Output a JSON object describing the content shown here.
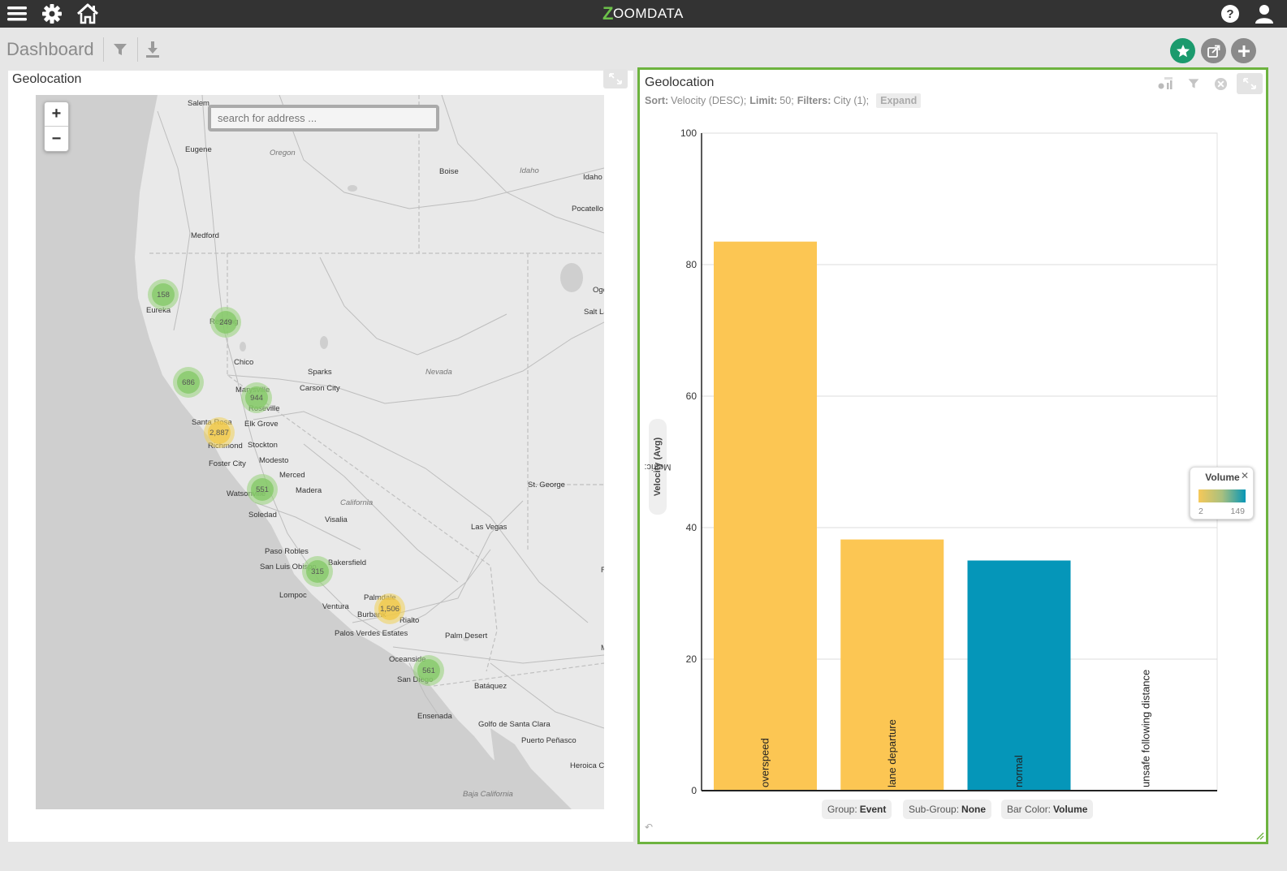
{
  "topbar": {
    "logo_mark": "Z",
    "logo_text": "OOMDATA",
    "icons": [
      "menu-icon",
      "gear-icon",
      "home-icon",
      "help-icon",
      "user-icon"
    ]
  },
  "dashboard": {
    "title": "Dashboard",
    "tools": [
      "filter-icon",
      "download-icon"
    ],
    "actions": [
      "star-icon",
      "share-icon",
      "add-icon"
    ],
    "colors": {
      "star": "#1b9a6d",
      "share": "#8a8a8a",
      "add": "#8a8a8a",
      "panel_border": "#6db33f"
    }
  },
  "map_panel": {
    "title": "Geolocation",
    "search_placeholder": "search for address ...",
    "zoom_in": "+",
    "zoom_out": "−",
    "places": [
      {
        "name": "Salem",
        "cls": ""
      },
      {
        "name": "Eugene",
        "cls": ""
      },
      {
        "name": "Oregon",
        "cls": "region"
      },
      {
        "name": "Boise",
        "cls": ""
      },
      {
        "name": "Idaho",
        "cls": "region"
      },
      {
        "name": "Idaho F",
        "cls": ""
      },
      {
        "name": "Pocatello",
        "cls": ""
      },
      {
        "name": "Medford",
        "cls": ""
      },
      {
        "name": "Ogo",
        "cls": ""
      },
      {
        "name": "Salt La",
        "cls": ""
      },
      {
        "name": "Eureka",
        "cls": ""
      },
      {
        "name": "Redding",
        "cls": ""
      },
      {
        "name": "Chico",
        "cls": ""
      },
      {
        "name": "Sparks",
        "cls": ""
      },
      {
        "name": "Nevada",
        "cls": "region"
      },
      {
        "name": "Carson City",
        "cls": ""
      },
      {
        "name": "Marysville",
        "cls": ""
      },
      {
        "name": "Roseville",
        "cls": ""
      },
      {
        "name": "Santa Rosa",
        "cls": ""
      },
      {
        "name": "Elk Grove",
        "cls": ""
      },
      {
        "name": "Richmond",
        "cls": ""
      },
      {
        "name": "Stockton",
        "cls": ""
      },
      {
        "name": "Modesto",
        "cls": ""
      },
      {
        "name": "Foster City",
        "cls": ""
      },
      {
        "name": "Merced",
        "cls": ""
      },
      {
        "name": "Watsonville",
        "cls": ""
      },
      {
        "name": "Madera",
        "cls": ""
      },
      {
        "name": "California",
        "cls": "region"
      },
      {
        "name": "St. George",
        "cls": ""
      },
      {
        "name": "Soledad",
        "cls": ""
      },
      {
        "name": "Visalia",
        "cls": ""
      },
      {
        "name": "Las Vegas",
        "cls": ""
      },
      {
        "name": "Paso Robles",
        "cls": ""
      },
      {
        "name": "Bakersfield",
        "cls": ""
      },
      {
        "name": "San Luis Obispo",
        "cls": ""
      },
      {
        "name": "Lompoc",
        "cls": ""
      },
      {
        "name": "Palmdale",
        "cls": ""
      },
      {
        "name": "Ventura",
        "cls": ""
      },
      {
        "name": "Burbank",
        "cls": ""
      },
      {
        "name": "Rialto",
        "cls": ""
      },
      {
        "name": "Palos Verdes Estates",
        "cls": ""
      },
      {
        "name": "Palm Desert",
        "cls": ""
      },
      {
        "name": "Oceanside",
        "cls": ""
      },
      {
        "name": "San Diego",
        "cls": ""
      },
      {
        "name": "Batáquez",
        "cls": ""
      },
      {
        "name": "Ensenada",
        "cls": ""
      },
      {
        "name": "Golfo de Santa Clara",
        "cls": ""
      },
      {
        "name": "Puerto Peñasco",
        "cls": ""
      },
      {
        "name": "Heroica Ca",
        "cls": ""
      },
      {
        "name": "Baja California",
        "cls": "region"
      },
      {
        "name": "F",
        "cls": ""
      },
      {
        "name": "M",
        "cls": ""
      }
    ],
    "clusters": [
      {
        "count": "158",
        "color": "green"
      },
      {
        "count": "249",
        "color": "green"
      },
      {
        "count": "686",
        "color": "green"
      },
      {
        "count": "944",
        "color": "green"
      },
      {
        "count": "2,887",
        "color": "yellow"
      },
      {
        "count": "551",
        "color": "green"
      },
      {
        "count": "315",
        "color": "green"
      },
      {
        "count": "1,506",
        "color": "yellow"
      },
      {
        "count": "561",
        "color": "green"
      }
    ]
  },
  "chart_panel": {
    "title": "Geolocation",
    "meta": {
      "sort_label": "Sort:",
      "sort_value": "Velocity (DESC);",
      "limit_label": "Limit:",
      "limit_value": "50;",
      "filters_label": "Filters:",
      "filters_value": "City (1);",
      "expand_label": "Expand"
    },
    "metric_prefix": "Metric:",
    "metric_value": "Velocity (Avg)",
    "legend": {
      "title": "Volume",
      "close": "✕",
      "min": "2",
      "max": "149"
    },
    "pills": [
      {
        "label": "Group:",
        "value": "Event"
      },
      {
        "label": "Sub-Group:",
        "value": "None"
      },
      {
        "label": "Bar Color:",
        "value": "Volume"
      }
    ],
    "undo": "↶"
  },
  "chart_data": {
    "type": "bar",
    "categories": [
      "overspeed",
      "lane departure",
      "normal",
      "unsafe following distance"
    ],
    "values": [
      83.5,
      38.2,
      35.0,
      0
    ],
    "colors": [
      "#fcc653",
      "#fcc653",
      "#0596b9",
      "#fcc653"
    ],
    "ylabel": "Velocity (Avg)",
    "ylim": [
      0,
      100
    ],
    "yticks": [
      0,
      20,
      40,
      60,
      80,
      100
    ],
    "grid": true,
    "legend_position": "right"
  }
}
